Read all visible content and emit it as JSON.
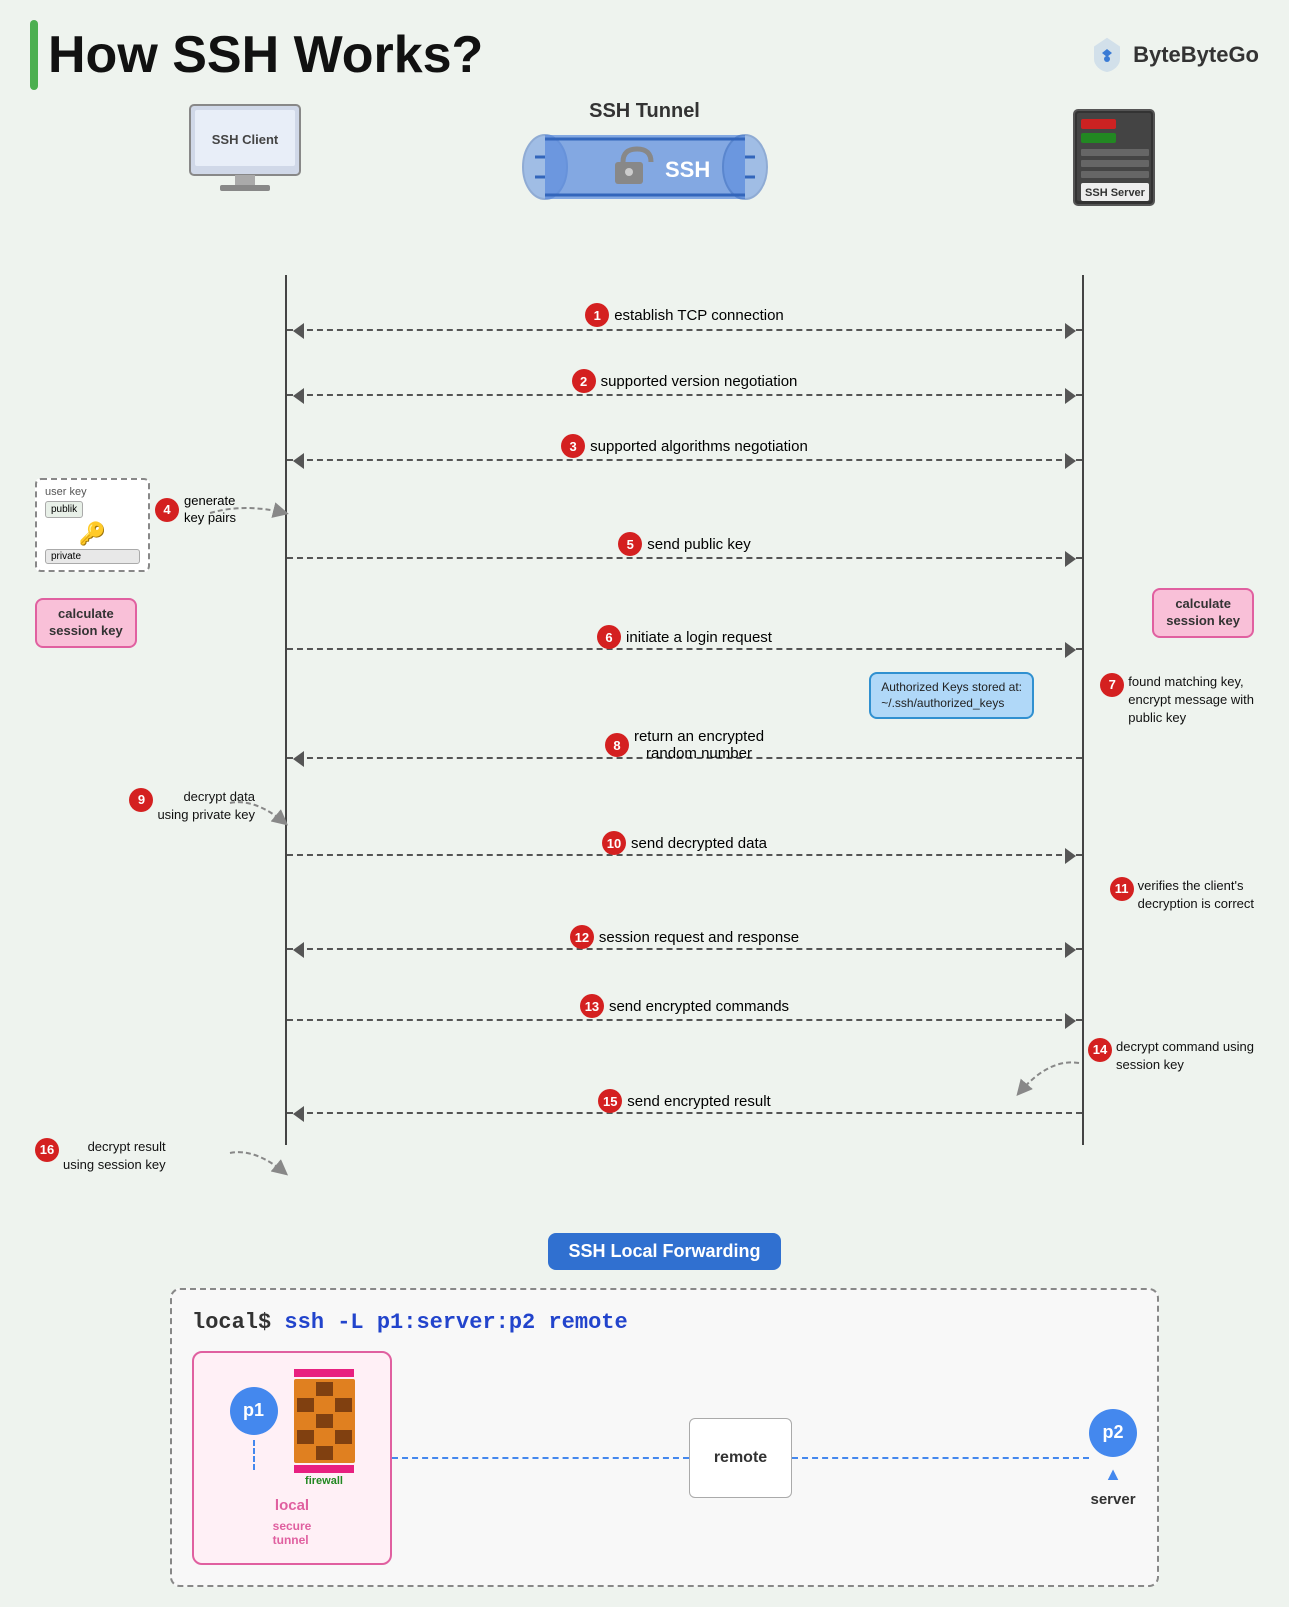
{
  "title": "How SSH Works?",
  "logo": {
    "name": "ByteByteGo",
    "icon": "shield"
  },
  "client_label": "SSH Client",
  "server_label": "SSH Server",
  "tunnel_label": "SSH Tunnel",
  "tunnel_text": "SSH",
  "steps": [
    {
      "num": "1",
      "text": "establish TCP connection",
      "dir": "bidir"
    },
    {
      "num": "2",
      "text": "supported version negotiation",
      "dir": "bidir"
    },
    {
      "num": "3",
      "text": "supported algorithms negotiation",
      "dir": "bidir"
    },
    {
      "num": "4",
      "text": "generate key pairs",
      "dir": "left_note",
      "arrow": "none"
    },
    {
      "num": "5",
      "text": "send public key",
      "dir": "ltr"
    },
    {
      "num": "6",
      "text": "initiate a login request",
      "dir": "ltr"
    },
    {
      "num": "7",
      "text": "found matching key,\nencrypt message with\npublic key",
      "dir": "right_note",
      "arrow": "none"
    },
    {
      "num": "8",
      "text": "return an encrypted\nrandom number",
      "dir": "rtl"
    },
    {
      "num": "9",
      "text": "decrypt data\nusing private key",
      "dir": "left_note",
      "arrow": "none"
    },
    {
      "num": "10",
      "text": "send decrypted data",
      "dir": "ltr"
    },
    {
      "num": "11",
      "text": "verifies the client's\ndecryption is correct",
      "dir": "right_note",
      "arrow": "none"
    },
    {
      "num": "12",
      "text": "session request and response",
      "dir": "bidir"
    },
    {
      "num": "13",
      "text": "send encrypted commands",
      "dir": "ltr"
    },
    {
      "num": "14",
      "text": "decrypt command using\nsession key",
      "dir": "right_note",
      "arrow": "none"
    },
    {
      "num": "15",
      "text": "send encrypted result",
      "dir": "rtl"
    },
    {
      "num": "16",
      "text": "decrypt result\nusing session key",
      "dir": "left_note",
      "arrow": "none"
    }
  ],
  "session_key_left": "calculate\nsession key",
  "session_key_right": "calculate\nsession key",
  "authorized_keys": "Authorized Keys stored at:\n~/.ssh/authorized_keys",
  "forwarding": {
    "title": "SSH Local Forwarding",
    "command": "local$  ssh  -L p1:server:p2 remote",
    "p1": "p1",
    "p2": "p2",
    "local_label": "local",
    "remote_label": "remote",
    "server_label": "server",
    "firewall_label": "firewall",
    "secure_tunnel_label": "secure\ntunnel"
  }
}
